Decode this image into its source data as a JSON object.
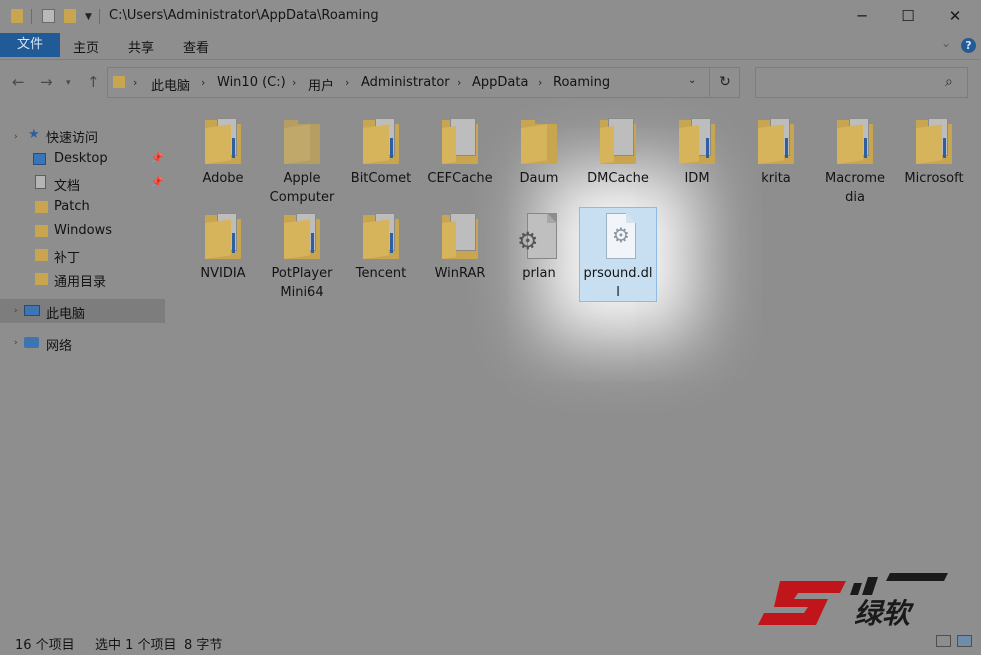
{
  "window": {
    "title": "C:\\Users\\Administrator\\AppData\\Roaming",
    "minimize_icon": "minimize-icon",
    "maximize_icon": "maximize-icon",
    "close_icon": "close-icon"
  },
  "ribbon": {
    "tabs": [
      "文件",
      "主页",
      "共享",
      "查看"
    ],
    "help_glyph": "?"
  },
  "address": {
    "breadcrumbs": [
      "此电脑",
      "Win10 (C:)",
      "用户",
      "Administrator",
      "AppData",
      "Roaming"
    ],
    "search_placeholder": ""
  },
  "nav": {
    "quick_access": "快速访问",
    "items": [
      {
        "label": "Desktop",
        "icon": "desktop-icon",
        "pinned": true
      },
      {
        "label": "文档",
        "icon": "document-icon",
        "pinned": true
      },
      {
        "label": "Patch",
        "icon": "folder-icon",
        "pinned": false
      },
      {
        "label": "Windows",
        "icon": "folder-icon",
        "pinned": false
      },
      {
        "label": "补丁",
        "icon": "folder-icon",
        "pinned": false
      },
      {
        "label": "通用目录",
        "icon": "folder-icon",
        "pinned": false
      }
    ],
    "this_pc": "此电脑",
    "network": "网络"
  },
  "files": [
    {
      "name": "Adobe",
      "type": "folder"
    },
    {
      "name": "Apple\nComputer",
      "type": "folder"
    },
    {
      "name": "BitComet",
      "type": "folder"
    },
    {
      "name": "CEFCache",
      "type": "folder"
    },
    {
      "name": "Daum",
      "type": "folder"
    },
    {
      "name": "DMCache",
      "type": "folder"
    },
    {
      "name": "IDM",
      "type": "folder"
    },
    {
      "name": "krita",
      "type": "folder"
    },
    {
      "name": "Macrome\ndia",
      "type": "folder"
    },
    {
      "name": "Microsoft",
      "type": "folder"
    },
    {
      "name": "NVIDIA",
      "type": "folder"
    },
    {
      "name": "PotPlayer\nMini64",
      "type": "folder"
    },
    {
      "name": "Tencent",
      "type": "folder"
    },
    {
      "name": "WinRAR",
      "type": "folder"
    },
    {
      "name": "prlan",
      "type": "file-settings"
    },
    {
      "name": "prsound.dl\nl",
      "type": "file-dll",
      "selected": true
    }
  ],
  "status": {
    "count": "16 个项目",
    "selection": "选中 1 个项目",
    "size": "8 字节"
  },
  "watermark": {
    "text": "绿软",
    "colors": {
      "accent": "#c0161b",
      "dark": "#1a1a1a"
    }
  }
}
